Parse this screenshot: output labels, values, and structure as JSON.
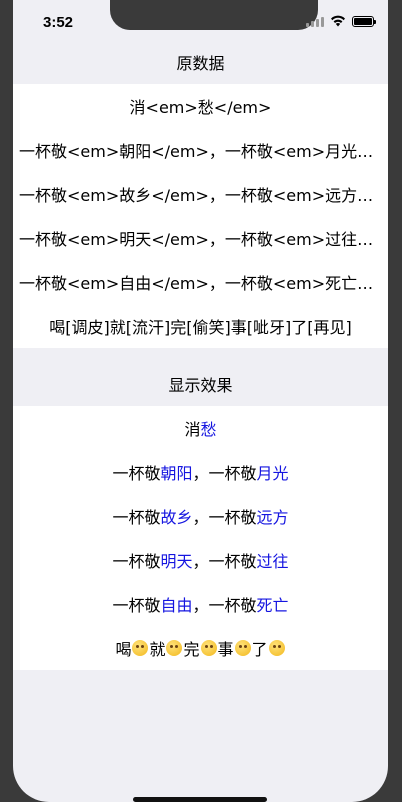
{
  "status_bar": {
    "time": "3:52"
  },
  "original": {
    "header": "原数据",
    "rows": [
      "消<em>愁</em>",
      "一杯敬<em>朝阳</em>，一杯敬<em>月光</em>",
      "一杯敬<em>故乡</em>，一杯敬<em>远方</em>",
      "一杯敬<em>明天</em>，一杯敬<em>过往</em>",
      "一杯敬<em>自由</em>，一杯敬<em>死亡</em>",
      "喝[调皮]就[流汗]完[偷笑]事[呲牙]了[再见]"
    ]
  },
  "display": {
    "header": "显示效果",
    "rows": [
      {
        "parts": [
          "消",
          "愁"
        ]
      },
      {
        "parts": [
          "一杯敬",
          "朝阳",
          "，一杯敬",
          "月光"
        ]
      },
      {
        "parts": [
          "一杯敬",
          "故乡",
          "，一杯敬",
          "远方"
        ]
      },
      {
        "parts": [
          "一杯敬",
          "明天",
          "，一杯敬",
          "过往"
        ]
      },
      {
        "parts": [
          "一杯敬",
          "自由",
          "，一杯敬",
          "死亡"
        ]
      },
      {
        "parts": [
          "喝",
          "就",
          "完",
          "事",
          "了"
        ],
        "emoji": [
          "tongue-out-emoji",
          "sweat-emoji",
          "smirk-emoji",
          "grin-emoji",
          "wave-emoji"
        ]
      }
    ]
  },
  "colors": {
    "highlight": "#1515e0",
    "background": "#efeff4"
  }
}
